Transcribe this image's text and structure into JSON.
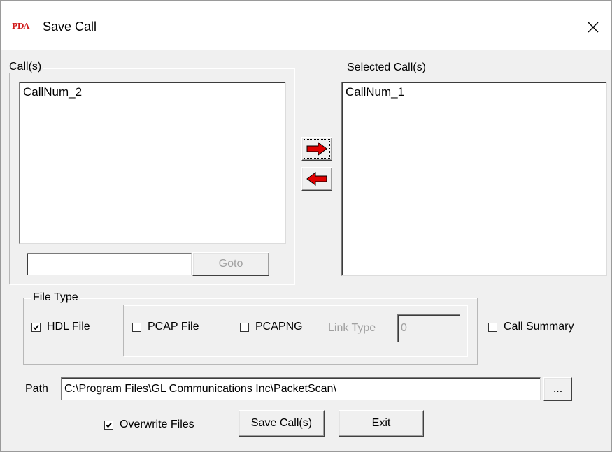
{
  "window": {
    "app_icon_text": "PDA",
    "title": "Save Call",
    "close_glyph": "✕"
  },
  "calls_panel": {
    "label": "Call(s)",
    "items": [
      "CallNum_2"
    ],
    "goto_input_value": "",
    "goto_button": "Goto"
  },
  "selected_panel": {
    "label": "Selected Call(s)",
    "items": [
      "CallNum_1"
    ]
  },
  "transfer_buttons": {
    "add_icon": "red-right-arrow-icon",
    "remove_icon": "red-left-arrow-icon",
    "arrow_color": "#e00000"
  },
  "file_type": {
    "label": "File Type",
    "hdl": {
      "label": "HDL File",
      "checked": true
    },
    "pcap": {
      "label": "PCAP File",
      "checked": false
    },
    "pcapng": {
      "label": "PCAPNG",
      "checked": false
    },
    "link_type_label": "Link Type",
    "link_type_value": "0"
  },
  "call_summary": {
    "label": "Call Summary",
    "checked": false
  },
  "path": {
    "label": "Path",
    "value": "C:\\Program Files\\GL Communications Inc\\PacketScan\\",
    "browse_label": "..."
  },
  "footer": {
    "overwrite": {
      "label": "Overwrite Files",
      "checked": true
    },
    "save_button": "Save Call(s)",
    "exit_button": "Exit"
  }
}
